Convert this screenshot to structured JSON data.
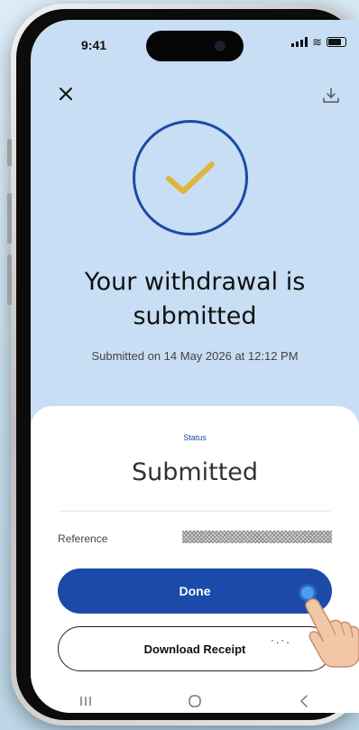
{
  "status_bar": {
    "time": "9:41"
  },
  "nav": {
    "close_icon": "close-icon",
    "download_icon": "download-icon"
  },
  "hero": {
    "icon": "check-icon",
    "title_line1": "Your withdrawal is",
    "title_line2": "submitted",
    "subtitle": "Submitted on 14 May 2026 at 12:12 PM"
  },
  "sheet": {
    "status_label": "Status",
    "status_value": "Submitted",
    "reference_label": "Reference",
    "done_label": "Done",
    "download_receipt_label": "Download Receipt"
  },
  "colors": {
    "accent": "#1b4aa8",
    "hero_background": "#c7def4",
    "check_color": "#e0b43a"
  }
}
